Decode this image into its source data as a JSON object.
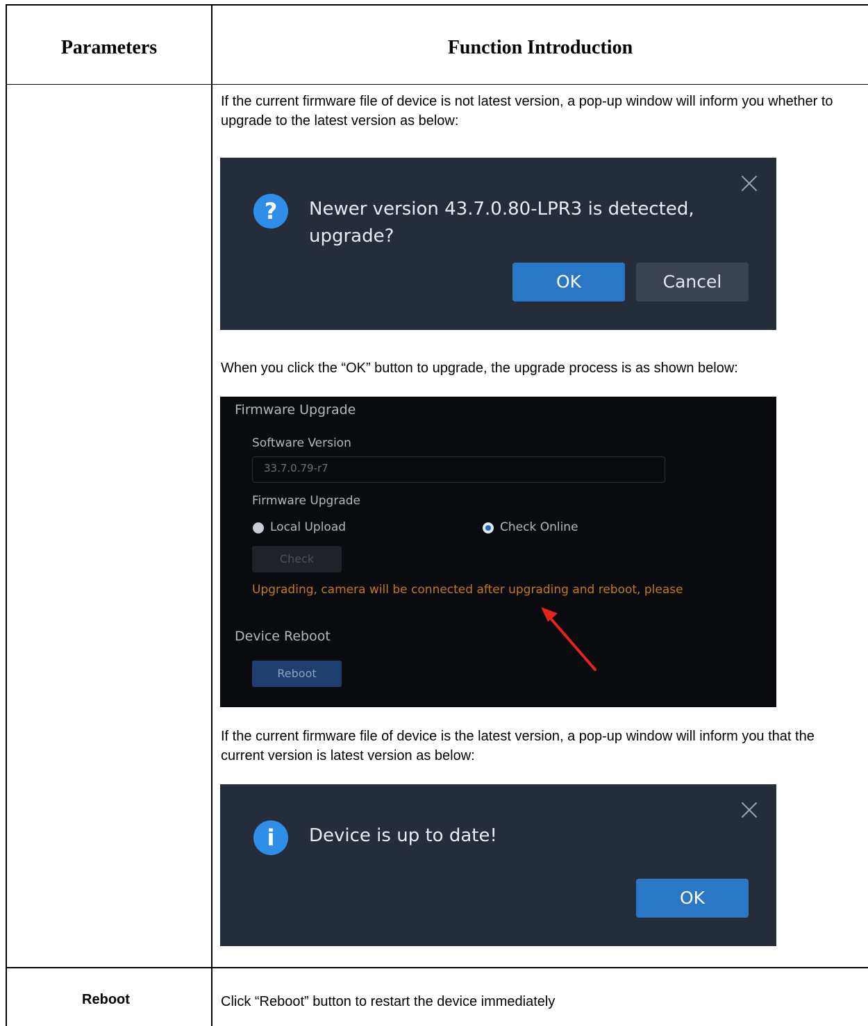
{
  "table": {
    "header": {
      "parameters": "Parameters",
      "function_introduction": "Function Introduction"
    },
    "row1": {
      "para_not_latest": "If the current firmware file of device is not latest version, a pop-up window will inform you whether to upgrade to the latest version as below:",
      "para_click_ok": "When you click the “OK” button to upgrade, the upgrade process is as shown below:",
      "para_latest": "If the current firmware file of device is the latest version, a pop-up window will inform you that the current version is latest version as below:"
    },
    "row2": {
      "parameter": "Reboot",
      "description": "Click “Reboot” button to restart the device immediately"
    }
  },
  "upgrade_dialog": {
    "icon": "question-icon",
    "icon_glyph": "?",
    "message": "Newer version 43.7.0.80-LPR3 is detected, upgrade?",
    "ok_label": "OK",
    "cancel_label": "Cancel"
  },
  "firmware_panel": {
    "section_title": "Firmware Upgrade",
    "software_version_label": "Software Version",
    "software_version_value": "33.7.0.79-r7",
    "firmware_upgrade_label": "Firmware Upgrade",
    "local_upload_label": "Local Upload",
    "check_online_label": "Check Online",
    "selected_option": "Check Online",
    "check_button": "Check",
    "status_message": "Upgrading, camera will be connected after upgrading and reboot, please",
    "device_reboot_title": "Device Reboot",
    "reboot_button": "Reboot",
    "status_color": "#c07a1c",
    "annotation_arrow_color": "#e8231b"
  },
  "uptodate_dialog": {
    "icon": "info-icon",
    "icon_glyph": "i",
    "message": "Device is up to date!",
    "ok_label": "OK"
  }
}
